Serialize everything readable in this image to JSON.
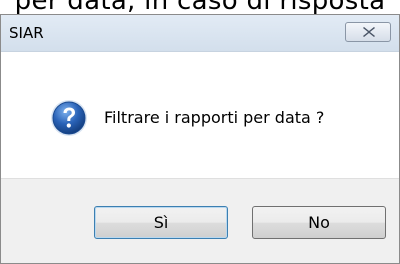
{
  "background": {
    "text": "per data, in caso di risposta"
  },
  "window": {
    "title": "SIAR",
    "close_icon": "close-icon"
  },
  "message": {
    "icon": "question-icon",
    "text": "Filtrare i rapporti per data ?"
  },
  "buttons": {
    "yes_label": "Sì",
    "no_label": "No"
  },
  "colors": {
    "titlebar": "#dbe6f1",
    "content_bg": "#ffffff",
    "footer_bg": "#f0f0f0",
    "icon_blue": "#2a63b8"
  }
}
